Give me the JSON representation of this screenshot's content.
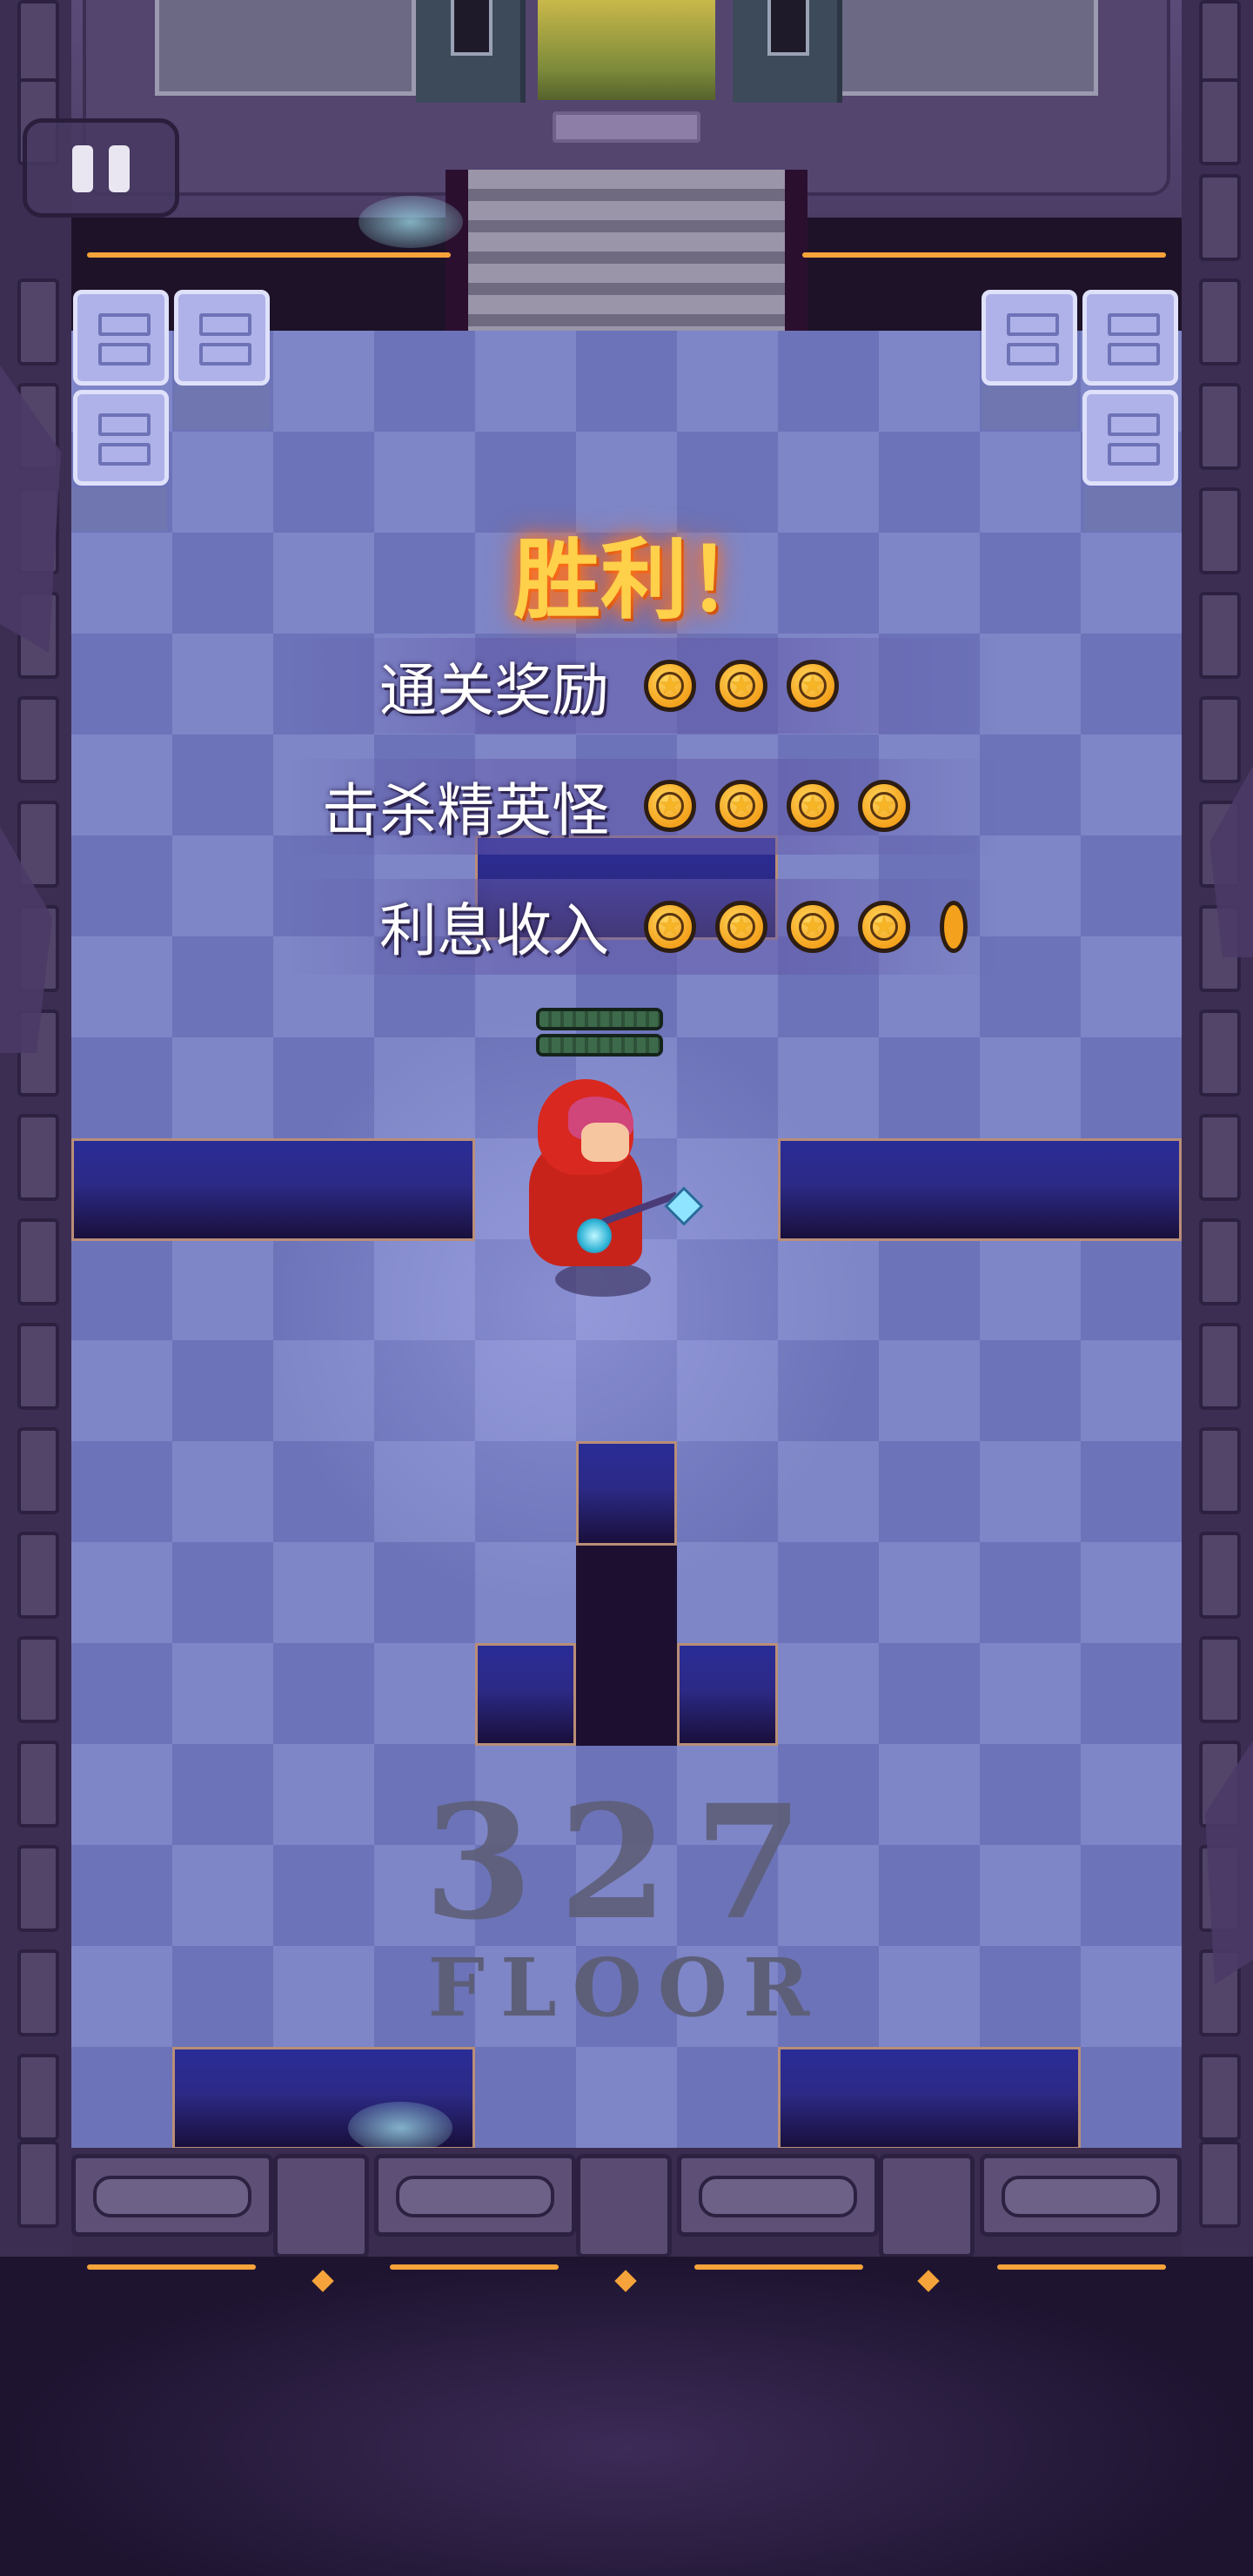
{
  "hud": {
    "pause_icon": "pause-icon"
  },
  "victory": {
    "title": "胜利！",
    "rewards": [
      {
        "label": "通关奖励",
        "coins": 3
      },
      {
        "label": "击杀精英怪",
        "coins": 4
      },
      {
        "label": "利息收入",
        "coins": 4,
        "partial_coin": true
      }
    ]
  },
  "floor": {
    "number": "327",
    "label": "FLOOR"
  },
  "hero": {
    "health_fraction": 1.0,
    "shield_fraction": 1.0
  },
  "colors": {
    "accent_orange": "#f5a33a",
    "victory_gold": "#ffd04a",
    "coin_gold": "#f4a21d"
  }
}
